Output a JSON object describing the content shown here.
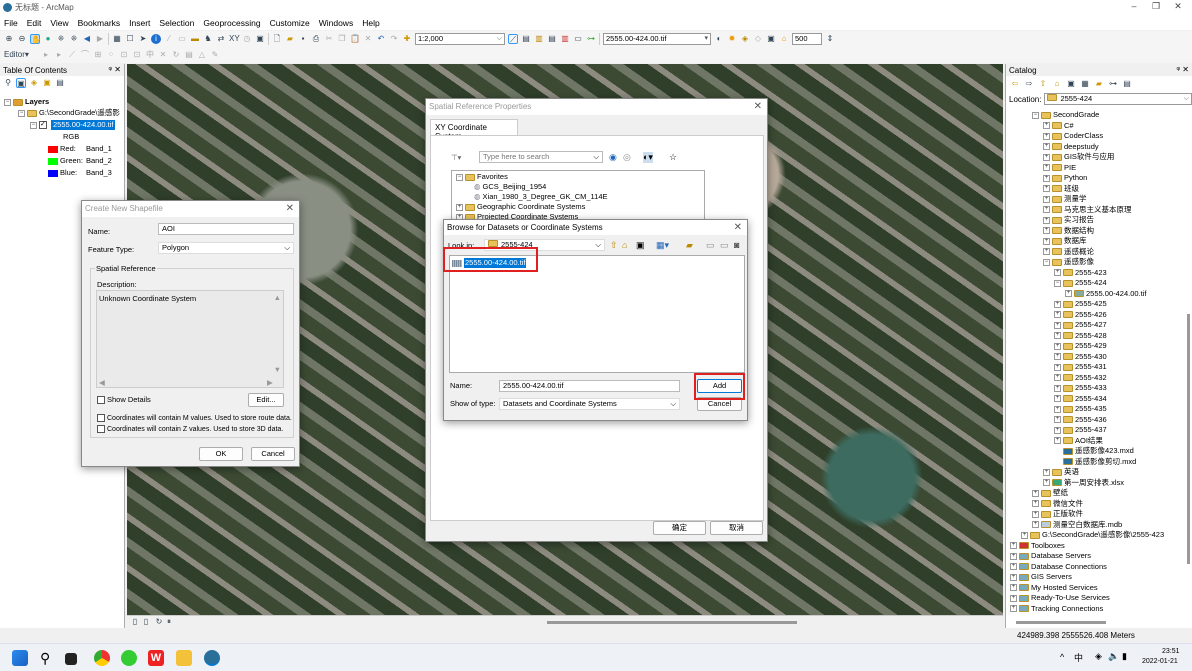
{
  "window": {
    "title": "无标题 - ArcMap"
  },
  "menu": [
    "File",
    "Edit",
    "View",
    "Bookmarks",
    "Insert",
    "Selection",
    "Geoprocessing",
    "Customize",
    "Windows",
    "Help"
  ],
  "toolbar": {
    "scale": "1:2,000",
    "layer_combo": "2555.00-424.00.tif",
    "tolerance": "500",
    "editor_label": "Editor"
  },
  "toc": {
    "title": "Table Of Contents",
    "layers_label": "Layers",
    "group": "G:\\SecondGrade\\遥感影",
    "layer": "2555.00-424.00.tif",
    "rgb": "RGB",
    "bands": [
      {
        "label": "Red:",
        "band": "Band_1",
        "color": "#ff0000"
      },
      {
        "label": "Green:",
        "band": "Band_2",
        "color": "#00ff00"
      },
      {
        "label": "Blue:",
        "band": "Band_3",
        "color": "#0000ff"
      }
    ]
  },
  "catalog": {
    "title": "Catalog",
    "location_label": "Location:",
    "location": "2555-424",
    "tree": [
      {
        "t": "SecondGrade",
        "l": 2,
        "e": "-",
        "k": "folder"
      },
      {
        "t": "C#",
        "l": 3,
        "e": "+",
        "k": "folder"
      },
      {
        "t": "CoderClass",
        "l": 3,
        "e": "+",
        "k": "folder"
      },
      {
        "t": "deepstudy",
        "l": 3,
        "e": "+",
        "k": "folder"
      },
      {
        "t": "GIS软件与应用",
        "l": 3,
        "e": "+",
        "k": "folder"
      },
      {
        "t": "PIE",
        "l": 3,
        "e": "+",
        "k": "folder"
      },
      {
        "t": "Python",
        "l": 3,
        "e": "+",
        "k": "folder"
      },
      {
        "t": "班级",
        "l": 3,
        "e": "+",
        "k": "folder"
      },
      {
        "t": "测量学",
        "l": 3,
        "e": "+",
        "k": "folder"
      },
      {
        "t": "马克思主义基本原理",
        "l": 3,
        "e": "+",
        "k": "folder"
      },
      {
        "t": "实习报告",
        "l": 3,
        "e": "+",
        "k": "folder"
      },
      {
        "t": "数据结构",
        "l": 3,
        "e": "+",
        "k": "folder"
      },
      {
        "t": "数据库",
        "l": 3,
        "e": "+",
        "k": "folder"
      },
      {
        "t": "遥感概论",
        "l": 3,
        "e": "+",
        "k": "folder"
      },
      {
        "t": "遥感影像",
        "l": 3,
        "e": "-",
        "k": "folder"
      },
      {
        "t": "2555-423",
        "l": 4,
        "e": "+",
        "k": "folder"
      },
      {
        "t": "2555-424",
        "l": 4,
        "e": "-",
        "k": "folder"
      },
      {
        "t": "2555.00-424.00.tif",
        "l": 5,
        "e": "+",
        "k": "raster"
      },
      {
        "t": "2555-425",
        "l": 4,
        "e": "+",
        "k": "folder"
      },
      {
        "t": "2555-426",
        "l": 4,
        "e": "+",
        "k": "folder"
      },
      {
        "t": "2555-427",
        "l": 4,
        "e": "+",
        "k": "folder"
      },
      {
        "t": "2555-428",
        "l": 4,
        "e": "+",
        "k": "folder"
      },
      {
        "t": "2555-429",
        "l": 4,
        "e": "+",
        "k": "folder"
      },
      {
        "t": "2555-430",
        "l": 4,
        "e": "+",
        "k": "folder"
      },
      {
        "t": "2555-431",
        "l": 4,
        "e": "+",
        "k": "folder"
      },
      {
        "t": "2555-432",
        "l": 4,
        "e": "+",
        "k": "folder"
      },
      {
        "t": "2555-433",
        "l": 4,
        "e": "+",
        "k": "folder"
      },
      {
        "t": "2555-434",
        "l": 4,
        "e": "+",
        "k": "folder"
      },
      {
        "t": "2555-435",
        "l": 4,
        "e": "+",
        "k": "folder"
      },
      {
        "t": "2555-436",
        "l": 4,
        "e": "+",
        "k": "folder"
      },
      {
        "t": "2555-437",
        "l": 4,
        "e": "+",
        "k": "folder"
      },
      {
        "t": "AOI结果",
        "l": 4,
        "e": "+",
        "k": "folder"
      },
      {
        "t": "遥感影像423.mxd",
        "l": 4,
        "e": "",
        "k": "mxd"
      },
      {
        "t": "遥感影像剪切.mxd",
        "l": 4,
        "e": "",
        "k": "mxd"
      },
      {
        "t": "英语",
        "l": 3,
        "e": "+",
        "k": "folder"
      },
      {
        "t": "第一周安排表.xlsx",
        "l": 3,
        "e": "+",
        "k": "xlsx"
      },
      {
        "t": "壁纸",
        "l": 2,
        "e": "+",
        "k": "folder"
      },
      {
        "t": "微信文件",
        "l": 2,
        "e": "+",
        "k": "folder"
      },
      {
        "t": "正版软件",
        "l": 2,
        "e": "+",
        "k": "folder"
      },
      {
        "t": "测量空白数据库.mdb",
        "l": 2,
        "e": "+",
        "k": "db"
      },
      {
        "t": "G:\\SecondGrade\\遥感影像\\2555-423",
        "l": 1,
        "e": "+",
        "k": "folder"
      },
      {
        "t": "Toolboxes",
        "l": 0,
        "e": "+",
        "k": "toolbox"
      },
      {
        "t": "Database Servers",
        "l": 0,
        "e": "+",
        "k": "server"
      },
      {
        "t": "Database Connections",
        "l": 0,
        "e": "+",
        "k": "server"
      },
      {
        "t": "GIS Servers",
        "l": 0,
        "e": "+",
        "k": "server"
      },
      {
        "t": "My Hosted Services",
        "l": 0,
        "e": "+",
        "k": "server"
      },
      {
        "t": "Ready-To-Use Services",
        "l": 0,
        "e": "+",
        "k": "server"
      },
      {
        "t": "Tracking Connections",
        "l": 0,
        "e": "+",
        "k": "server"
      }
    ]
  },
  "shapefile_dialog": {
    "title": "Create New Shapefile",
    "name_label": "Name:",
    "name_value": "AOI",
    "feature_type_label": "Feature Type:",
    "feature_type": "Polygon",
    "spatial_ref_label": "Spatial Reference",
    "description_label": "Description:",
    "description": "Unknown Coordinate System",
    "show_details": "Show Details",
    "edit": "Edit...",
    "m_values": "Coordinates will contain M values. Used to store route data.",
    "z_values": "Coordinates will contain Z values. Used to store 3D data.",
    "ok": "OK",
    "cancel": "Cancel"
  },
  "spatial_ref_dialog": {
    "title": "Spatial Reference Properties",
    "tab": "XY Coordinate System",
    "search_placeholder": "Type here to search",
    "favorites": "Favorites",
    "fav_items": [
      "GCS_Beijing_1954",
      "Xian_1980_3_Degree_GK_CM_114E"
    ],
    "geo": "Geographic Coordinate Systems",
    "proj": "Projected Coordinate Systems",
    "ok": "确定",
    "cancel": "取消"
  },
  "browse_dialog": {
    "title": "Browse for Datasets or Coordinate Systems",
    "look_in_label": "Look in:",
    "look_in": "2555-424",
    "item": "2555.00-424.00.tif",
    "name_label": "Name:",
    "name_value": "2555.00-424.00.tif",
    "type_label": "Show of type:",
    "type_value": "Datasets and Coordinate Systems",
    "add": "Add",
    "cancel": "Cancel"
  },
  "status": {
    "coords": "424989.398  2555526.408 Meters"
  },
  "taskbar": {
    "time": "23:51",
    "date": "2022-01-21",
    "ime": "中"
  },
  "colors": {
    "highlight": "#0078d7",
    "annotation": "#e02020"
  }
}
